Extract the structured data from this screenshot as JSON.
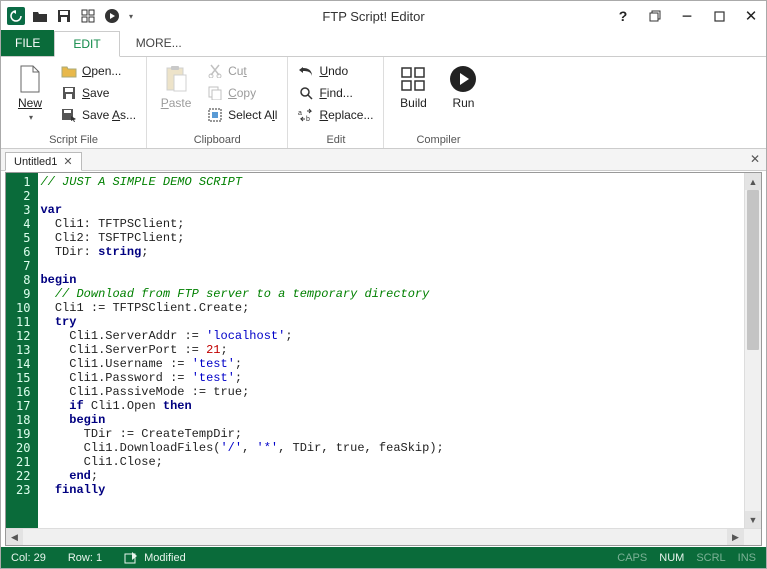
{
  "window": {
    "title": "FTP Script! Editor"
  },
  "tabs": {
    "file": "FILE",
    "edit": "EDIT",
    "more": "MORE..."
  },
  "ribbon": {
    "groups": {
      "script_file": {
        "label": "Script File",
        "new": "New",
        "open": "Open...",
        "save": "Save",
        "save_as": "Save As..."
      },
      "clipboard": {
        "label": "Clipboard",
        "paste": "Paste",
        "cut": "Cut",
        "copy": "Copy",
        "select_all": "Select All"
      },
      "edit": {
        "label": "Edit",
        "undo": "Undo",
        "find": "Find...",
        "replace": "Replace..."
      },
      "compiler": {
        "label": "Compiler",
        "build": "Build",
        "run": "Run"
      }
    }
  },
  "doc_tabs": {
    "untitled": "Untitled1"
  },
  "code_lines": [
    {
      "n": 1,
      "segments": [
        {
          "t": "// JUST A SIMPLE DEMO SCRIPT",
          "c": "c-comment"
        }
      ]
    },
    {
      "n": 2,
      "segments": []
    },
    {
      "n": 3,
      "segments": [
        {
          "t": "var",
          "c": "c-kw"
        }
      ]
    },
    {
      "n": 4,
      "segments": [
        {
          "t": "  Cli1: TFTPSClient;",
          "c": ""
        }
      ]
    },
    {
      "n": 5,
      "segments": [
        {
          "t": "  Cli2: TSFTPClient;",
          "c": ""
        }
      ]
    },
    {
      "n": 6,
      "segments": [
        {
          "t": "  TDir: ",
          "c": ""
        },
        {
          "t": "string",
          "c": "c-kw"
        },
        {
          "t": ";",
          "c": ""
        }
      ]
    },
    {
      "n": 7,
      "segments": []
    },
    {
      "n": 8,
      "segments": [
        {
          "t": "begin",
          "c": "c-kw"
        }
      ]
    },
    {
      "n": 9,
      "segments": [
        {
          "t": "  ",
          "c": ""
        },
        {
          "t": "// Download from FTP server to a temporary directory",
          "c": "c-comment"
        }
      ]
    },
    {
      "n": 10,
      "segments": [
        {
          "t": "  Cli1 := TFTPSClient.Create;",
          "c": ""
        }
      ]
    },
    {
      "n": 11,
      "segments": [
        {
          "t": "  ",
          "c": ""
        },
        {
          "t": "try",
          "c": "c-kw"
        }
      ]
    },
    {
      "n": 12,
      "segments": [
        {
          "t": "    Cli1.ServerAddr := ",
          "c": ""
        },
        {
          "t": "'localhost'",
          "c": "c-str"
        },
        {
          "t": ";",
          "c": ""
        }
      ]
    },
    {
      "n": 13,
      "segments": [
        {
          "t": "    Cli1.ServerPort := ",
          "c": ""
        },
        {
          "t": "21",
          "c": "c-num"
        },
        {
          "t": ";",
          "c": ""
        }
      ]
    },
    {
      "n": 14,
      "segments": [
        {
          "t": "    Cli1.Username := ",
          "c": ""
        },
        {
          "t": "'test'",
          "c": "c-str"
        },
        {
          "t": ";",
          "c": ""
        }
      ]
    },
    {
      "n": 15,
      "segments": [
        {
          "t": "    Cli1.Password := ",
          "c": ""
        },
        {
          "t": "'test'",
          "c": "c-str"
        },
        {
          "t": ";",
          "c": ""
        }
      ]
    },
    {
      "n": 16,
      "segments": [
        {
          "t": "    Cli1.PassiveMode := true;",
          "c": ""
        }
      ]
    },
    {
      "n": 17,
      "segments": [
        {
          "t": "    ",
          "c": ""
        },
        {
          "t": "if",
          "c": "c-kw"
        },
        {
          "t": " Cli1.Open ",
          "c": ""
        },
        {
          "t": "then",
          "c": "c-kw"
        }
      ]
    },
    {
      "n": 18,
      "segments": [
        {
          "t": "    ",
          "c": ""
        },
        {
          "t": "begin",
          "c": "c-kw"
        }
      ]
    },
    {
      "n": 19,
      "segments": [
        {
          "t": "      TDir := CreateTempDir;",
          "c": ""
        }
      ]
    },
    {
      "n": 20,
      "segments": [
        {
          "t": "      Cli1.DownloadFiles(",
          "c": ""
        },
        {
          "t": "'/'",
          "c": "c-str"
        },
        {
          "t": ", ",
          "c": ""
        },
        {
          "t": "'*'",
          "c": "c-str"
        },
        {
          "t": ", TDir, true, feaSkip);",
          "c": ""
        }
      ]
    },
    {
      "n": 21,
      "segments": [
        {
          "t": "      Cli1.Close;",
          "c": ""
        }
      ]
    },
    {
      "n": 22,
      "segments": [
        {
          "t": "    ",
          "c": ""
        },
        {
          "t": "end",
          "c": "c-kw"
        },
        {
          "t": ";",
          "c": ""
        }
      ]
    },
    {
      "n": 23,
      "segments": [
        {
          "t": "  ",
          "c": ""
        },
        {
          "t": "finally",
          "c": "c-kw"
        }
      ]
    }
  ],
  "status": {
    "col": "Col: 29",
    "row": "Row: 1",
    "modified": "Modified",
    "caps": "CAPS",
    "num": "NUM",
    "scrl": "SCRL",
    "ins": "INS"
  }
}
